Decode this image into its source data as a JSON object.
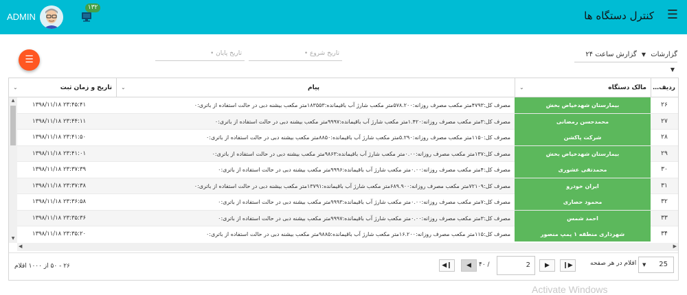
{
  "header": {
    "title": "کنترل دستگاه ها",
    "user": "ADMIN",
    "badge_count": "۱۳۲",
    "colors": {
      "bar": "#00bcd4",
      "badge": "#43a047"
    }
  },
  "toolbar": {
    "reports_label": "گزارشات",
    "report_type": "گزارش ساعت ۲۴",
    "start_date_placeholder": "تاریخ شروع",
    "end_date_placeholder": "تاریخ پایان",
    "fab_color": "#ff5722"
  },
  "grid": {
    "columns": {
      "index": "ردیف",
      "owner": "مالک دستگاه",
      "message": "پیام",
      "date": "تاریخ و زمان ثبت"
    },
    "owner_color": "#5cb85c",
    "rows": [
      {
        "idx": "۲۶",
        "owner": "بیمارستان شهدخیاض بخش",
        "msg": "مصرف کل:۴۷۹۳متر مکعب مصرف روزانه:۵۷۸.۲۰۰متر مکعب شارژ آب باقیمانده:۱۸۳۵۵۳متر مکعب بیشنه دبی در حالت استفاده از باتری:۰",
        "date": "۱۳۹۸/۱۱/۱۸ ۲۳:۴۵:۴۱"
      },
      {
        "idx": "۲۷",
        "owner": "محمدحسن رمضانی",
        "msg": "مصرف کل:۳متر مکعب مصرف روزانه:۱.۴۲۰متر مکعب شارژ آب باقیمانده:۹۹۹۷متر مکعب بیشنه دبی در حالت استفاده از باتری:۰",
        "date": "۱۳۹۸/۱۱/۱۸ ۲۳:۴۴:۱۱"
      },
      {
        "idx": "۲۸",
        "owner": "شرکت پاکشن",
        "msg": "مصرف کل:۱۱۵۰متر مکعب مصرف روزانه:۵.۲۹۰متر مکعب شارژ آب باقیمانده:۸۸۵۰متر مکعب بیشنه دبی در حالت استفاده از باتری:۰",
        "date": "۱۳۹۸/۱۱/۱۸ ۲۳:۴۱:۵۰"
      },
      {
        "idx": "۲۹",
        "owner": "بیمارستان شهدخیاض بخش",
        "msg": "مصرف کل:۱۳۷متر مکعب مصرف روزانه:۰.۰۰متر مکعب شارژ آب باقیمانده:۹۸۶۳متر مکعب بیشنه دبی در حالت استفاده از باتری:۰",
        "date": "۱۳۹۸/۱۱/۱۸ ۲۳:۴۱:۰۱"
      },
      {
        "idx": "۳۰",
        "owner": "محمدتقی عشوری",
        "msg": "مصرف کل:۴متر مکعب مصرف روزانه:۰.۰۰متر مکعب شارژ آب باقیمانده:۹۹۹۶متر مکعب بیشنه دبی در حالت استفاده از باتری:۰",
        "date": "۱۳۹۸/۱۱/۱۸ ۲۳:۳۷:۳۹"
      },
      {
        "idx": "۳۱",
        "owner": "ایران خودرو",
        "msg": "مصرف کل:۷۲۱۰۹متر مکعب مصرف روزانه:۶۸۹.۹۰۰متر مکعب شارژ آب باقیمانده:۱۳۷۹۱متر مکعب بیشنه دبی در حالت استفاده از باتری:۰",
        "date": "۱۳۹۸/۱۱/۱۸ ۲۳:۳۷:۳۸"
      },
      {
        "idx": "۳۲",
        "owner": "محمود حصاری",
        "msg": "مصرف کل:۷متر مکعب مصرف روزانه:۰.۰۰متر مکعب شارژ آب باقیمانده:۹۹۹۳متر مکعب بیشنه دبی در حالت استفاده از باتری:۰",
        "date": "۱۳۹۸/۱۱/۱۸ ۲۳:۳۶:۵۸"
      },
      {
        "idx": "۳۳",
        "owner": "احمد شمس",
        "msg": "مصرف کل:۳متر مکعب مصرف روزانه:۰.۰۰متر مکعب شارژ آب باقیمانده:۹۹۹۷متر مکعب بیشنه دبی در حالت استفاده از باتری:۰",
        "date": "۱۳۹۸/۱۱/۱۸ ۲۳:۳۵:۳۶"
      },
      {
        "idx": "۳۴",
        "owner": "شهرداری منطقه ۱ پمپ منصور",
        "msg": "مصرف کل:۱۱۵متر مکعب مصرف روزانه:۱۶.۲۰۰متر مکعب شارژ آب باقیمانده:۹۸۸۵متر مکعب بیشنه دبی در حالت استفاده از باتری:۰",
        "date": "۱۳۹۸/۱۱/۱۸ ۲۳:۳۵:۲۰"
      }
    ]
  },
  "pager": {
    "summary": "۲۶ - ۵۰ از ۱۰۰۰ اقلام",
    "current_page": "2",
    "of_total": "/ ۴۰",
    "per_page_label": "اقلام در هر صفحه",
    "per_page": "25"
  },
  "watermark": "Activate Windows"
}
